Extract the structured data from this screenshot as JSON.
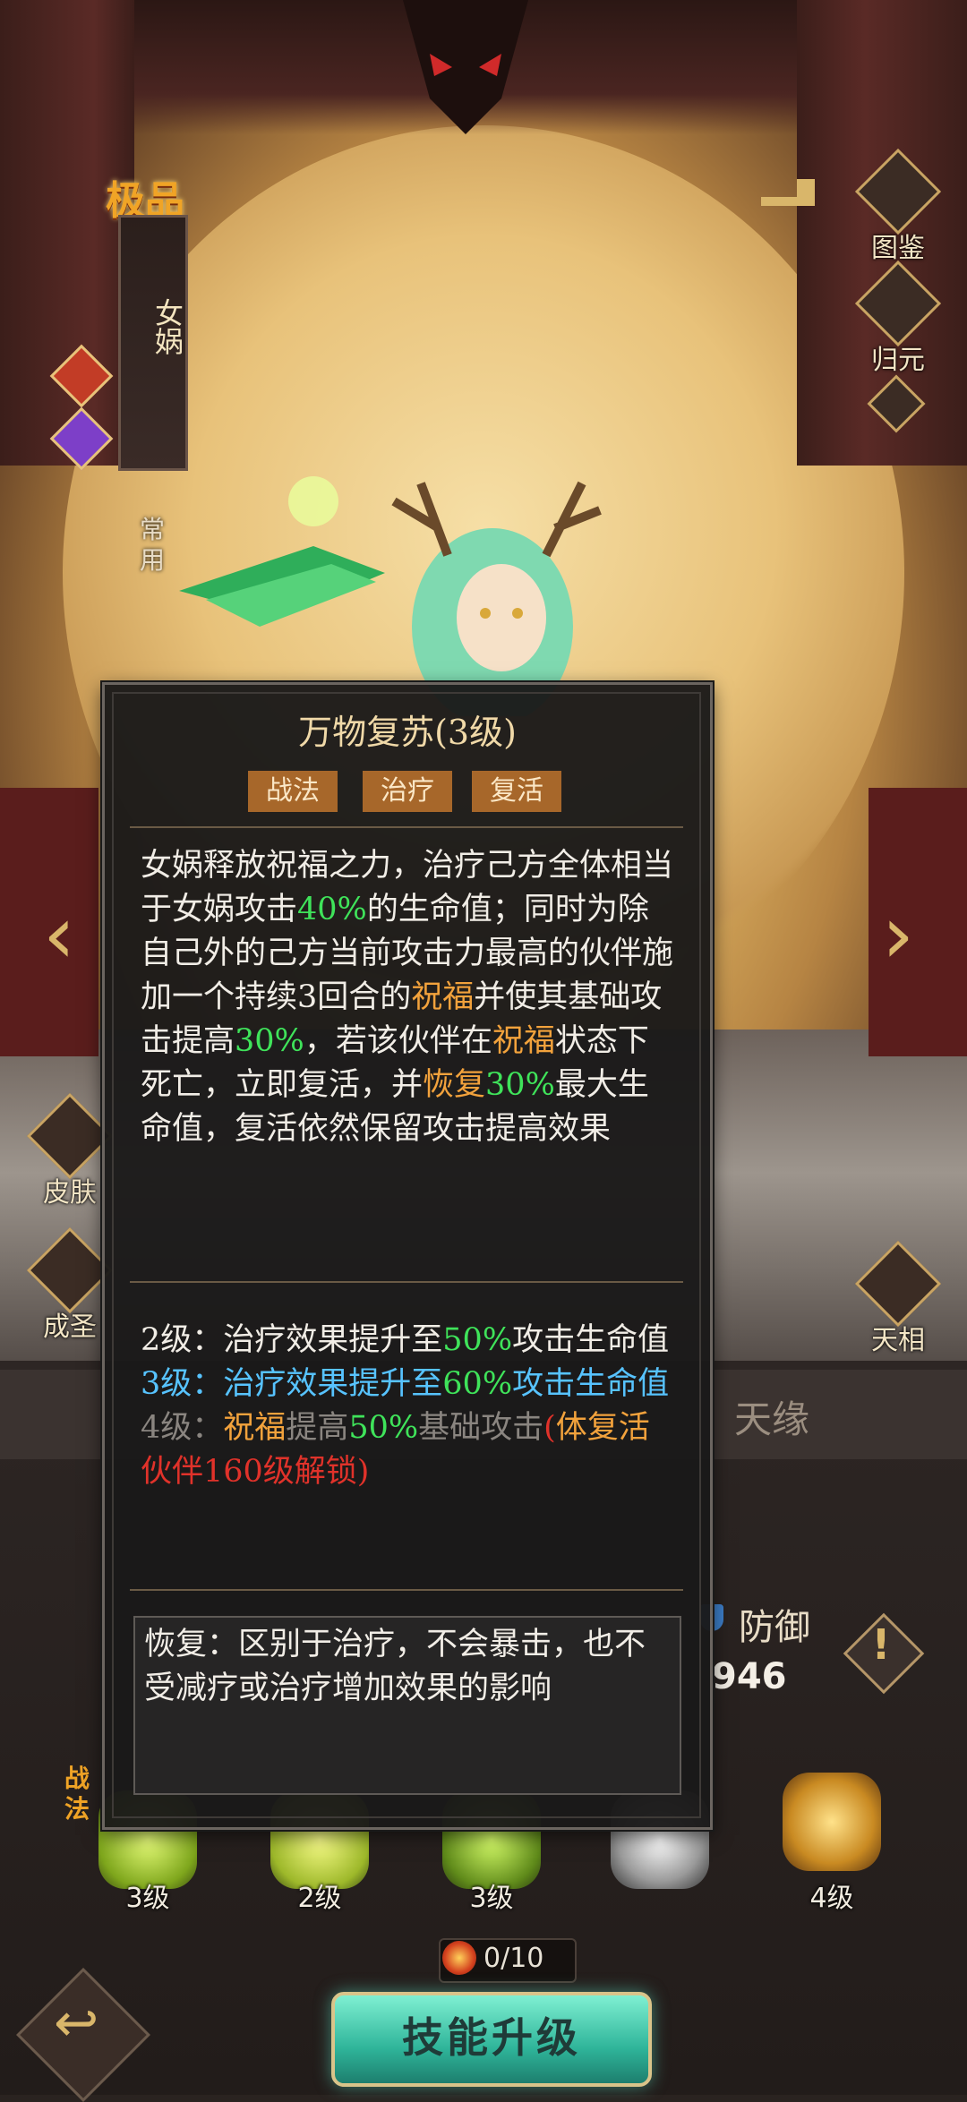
{
  "hero": {
    "rarity": "极品",
    "name": "女娲",
    "status_tag": "常用"
  },
  "side_menu": {
    "codex": "图鉴",
    "return": "归元",
    "skin": "皮肤",
    "ascend": "成圣",
    "celestial": "天相"
  },
  "tabs": {
    "fate": "天缘"
  },
  "stats": {
    "defense_label": "防御",
    "defense_value": "946"
  },
  "skills": {
    "section_tag": "战法",
    "levels": [
      "3级",
      "2级",
      "3级",
      "",
      "4级"
    ]
  },
  "resource": {
    "count": "0/10"
  },
  "buttons": {
    "upgrade": "技能升级",
    "warn": "!",
    "back": "↩"
  },
  "tooltip": {
    "title": "万物复苏(3级)",
    "tags": [
      "战法",
      "治疗",
      "复活"
    ],
    "desc": [
      {
        "t": "女娲释放祝福之力，治疗己方全体相当于女娲攻击"
      },
      {
        "t": "40%",
        "c": "g"
      },
      {
        "t": "的生命值；同时为除自己外的己方当前攻击力最高的伙伴施加一个持续3回合的"
      },
      {
        "t": "祝福",
        "c": "o"
      },
      {
        "t": "并使其基础攻击提高"
      },
      {
        "t": "30%",
        "c": "g"
      },
      {
        "t": "，若该伙伴在"
      },
      {
        "t": "祝福",
        "c": "o"
      },
      {
        "t": "状态下死亡，立即复活，并"
      },
      {
        "t": "恢复",
        "c": "o"
      },
      {
        "t": "30%",
        "c": "g"
      },
      {
        "t": "最大生命值，复活依然保留攻击提高效果"
      }
    ],
    "level2": [
      {
        "t": "2级：治疗效果提升至"
      },
      {
        "t": "50%",
        "c": "g"
      },
      {
        "t": "攻击生命值"
      }
    ],
    "level3": [
      {
        "t": "3级：治疗效果提升至",
        "c": "b"
      },
      {
        "t": "60%",
        "c": "g"
      },
      {
        "t": "攻击生命值",
        "c": "b"
      }
    ],
    "level4": [
      {
        "t": "4级：",
        "c": "dim"
      },
      {
        "t": "祝福",
        "c": "o"
      },
      {
        "t": "提高",
        "c": "dim"
      },
      {
        "t": "50%",
        "c": "g"
      },
      {
        "t": "基础攻击",
        "c": "dim"
      },
      {
        "t": "(",
        "c": "r"
      },
      {
        "t": "体复活",
        "c": "o"
      },
      {
        "t": "伙伴160级解锁)",
        "c": "r"
      }
    ],
    "note": "恢复：区别于治疗，不会暴击，也不受减疗或治疗增加效果的影响"
  },
  "colors": {
    "green": "#3fe35a",
    "orange": "#f2a23c",
    "blue": "#57c3ff",
    "red": "#e0322a",
    "tag_bg": "#a7672a",
    "upgrade_button": "#2fb59a"
  }
}
